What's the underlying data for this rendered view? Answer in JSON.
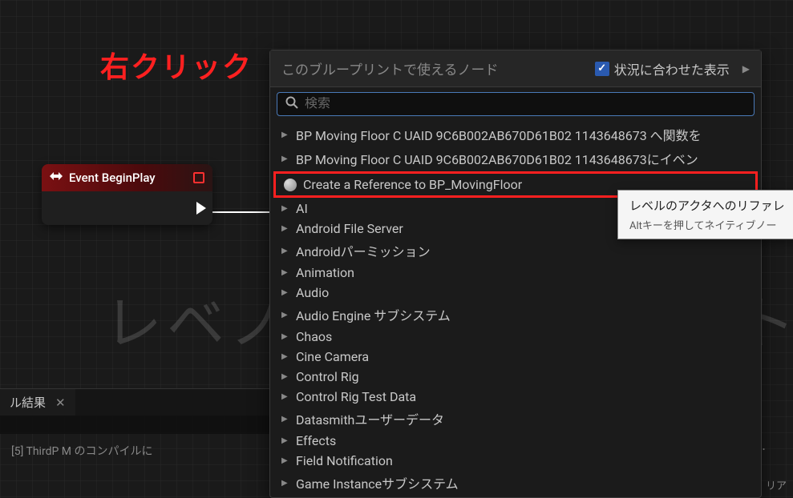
{
  "annotation": "右クリック",
  "background_text": "レベノ",
  "background_text_right": "ト",
  "event_node": {
    "title": "Event BeginPlay"
  },
  "context_menu": {
    "title": "このブループリントで使えるノード",
    "checkbox_label": "状況に合わせた表示",
    "search_placeholder": "検索",
    "items": [
      {
        "label": "BP Moving Floor C UAID 9C6B002AB670D61B02 1143648673 へ関数を",
        "expandable": true
      },
      {
        "label": "BP Moving Floor C UAID 9C6B002AB670D61B02 1143648673にイベン",
        "expandable": true
      },
      {
        "label": "Create a Reference to BP_MovingFloor",
        "expandable": false,
        "highlighted": true,
        "actor_icon": true
      },
      {
        "label": "AI",
        "expandable": true
      },
      {
        "label": "Android File Server",
        "expandable": true
      },
      {
        "label": "Androidパーミッション",
        "expandable": true
      },
      {
        "label": "Animation",
        "expandable": true
      },
      {
        "label": "Audio",
        "expandable": true
      },
      {
        "label": "Audio Engine サブシステム",
        "expandable": true
      },
      {
        "label": "Chaos",
        "expandable": true
      },
      {
        "label": "Cine Camera",
        "expandable": true
      },
      {
        "label": "Control Rig",
        "expandable": true
      },
      {
        "label": "Control Rig Test Data",
        "expandable": true
      },
      {
        "label": "Datasmithユーザーデータ",
        "expandable": true
      },
      {
        "label": "Effects",
        "expandable": true
      },
      {
        "label": "Field Notification",
        "expandable": true
      },
      {
        "label": "Game Instanceサブシステム",
        "expandable": true
      }
    ]
  },
  "tooltip": {
    "title": "レベルのアクタへのリファレ",
    "sub": "Altキーを押してネイティブノー"
  },
  "bottom_panel": {
    "tab_label": "ル結果"
  },
  "bottom_msg": "[5]  ThirdP              M         のコンパイルに",
  "bottom_right_text": "リア",
  "dots": "..."
}
